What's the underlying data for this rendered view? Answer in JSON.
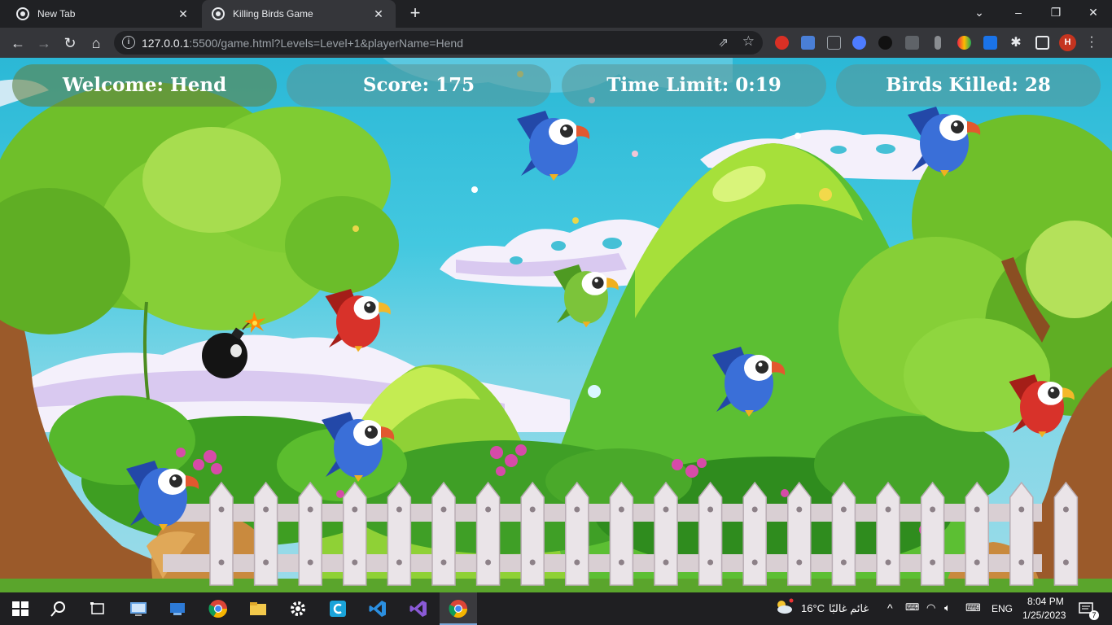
{
  "browser": {
    "tabs": [
      {
        "title": "New Tab"
      },
      {
        "title": "Killing Birds Game"
      }
    ],
    "new_tab_symbol": "+",
    "url_host": "127.0.0.1",
    "url_rest": ":5500/game.html?Levels=Level+1&playerName=Hend",
    "profile_initial": "H",
    "icons": [
      "back-icon",
      "forward-icon",
      "reload-icon",
      "home-icon",
      "site-info-icon",
      "share-icon",
      "bookmark-star-icon",
      "extensions-icon",
      "side-panel-icon",
      "menu-icon"
    ]
  },
  "hud": {
    "welcome": "Welcome: Hend",
    "score": "Score: 175",
    "time_limit": "Time Limit: 0:19",
    "birds_killed": "Birds Killed: 28"
  },
  "game": {
    "birds": [
      "blue-parrot",
      "blue-parrot",
      "blue-parrot",
      "blue-parrot",
      "blue-parrot",
      "green-parrot",
      "red-toucan",
      "red-toucan"
    ],
    "bomb": "bomb",
    "colors": {
      "sky": "#2bb8d6",
      "grass": "#4caa2a",
      "hud_text": "#ffffff"
    }
  },
  "taskbar": {
    "weather": "16°C",
    "weather_desc": "غائم غالبًا",
    "language": "ENG",
    "time": "8:04 PM",
    "date": "1/25/2023",
    "notification_count": "7"
  }
}
